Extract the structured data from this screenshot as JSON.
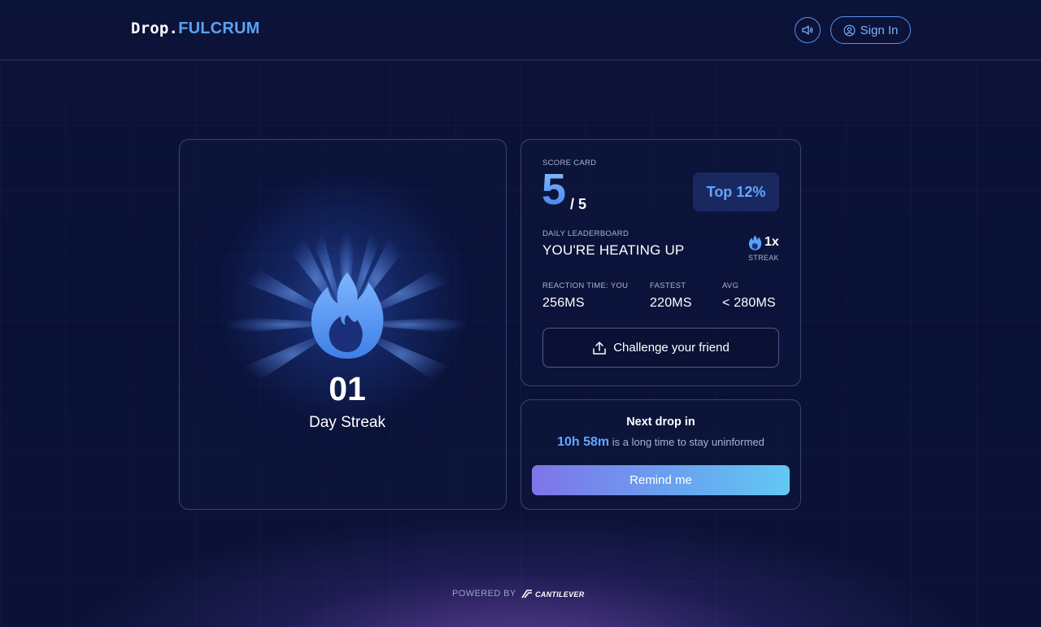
{
  "header": {
    "logo_part1": "Drop.",
    "logo_part2": "FULCRUM",
    "sound_icon": "speaker-icon",
    "signin_label": "Sign In",
    "signin_icon": "user-circle-icon"
  },
  "streak": {
    "icon": "flame-icon",
    "count": "01",
    "label": "Day Streak"
  },
  "scorecard": {
    "section_label": "SCORE CARD",
    "score": "5",
    "score_total": "/ 5",
    "rank_badge": "Top 12%",
    "leaderboard_label": "DAILY LEADERBOARD",
    "status_text": "YOU'RE HEATING UP",
    "multiplier": "1x",
    "multiplier_label": "STREAK",
    "stats": [
      {
        "label": "REACTION TIME: YOU",
        "value": "256MS"
      },
      {
        "label": "FASTEST",
        "value": "220MS"
      },
      {
        "label": "AVG",
        "value": "< 280MS"
      }
    ],
    "challenge_label": "Challenge your friend",
    "challenge_icon": "share-icon"
  },
  "next_drop": {
    "title": "Next drop in",
    "time": "10h 58m",
    "suffix": "is a long time to stay uninformed",
    "remind_label": "Remind me"
  },
  "footer": {
    "powered_by": "POWERED BY",
    "brand": "CANTILEVER"
  },
  "colors": {
    "accent_blue": "#5aa2f5",
    "background": "#0b1236",
    "button_gradient_start": "#7f74e8",
    "button_gradient_end": "#63c8f2"
  }
}
